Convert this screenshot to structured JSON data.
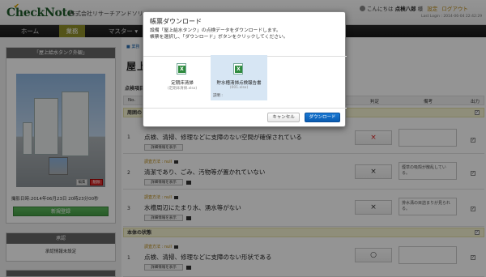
{
  "header": {
    "logo_text": "CheckNote",
    "company": "株式会社リサーチアンドソリュ",
    "greeting_prefix": "こんにちは",
    "user_name": "点検八郎",
    "user_suffix": "様",
    "settings_link": "設定",
    "logout_link": "ログアウト",
    "last_login": "Last Login : 2014-06-04 22:42:29"
  },
  "nav": {
    "home": "ホーム",
    "business": "業務",
    "master": "マスター",
    "master_caret": "▾"
  },
  "left": {
    "panel_title": "「屋上給水タンク外観」",
    "edit_label": "編集",
    "delete_label": "削除",
    "photo_date": "撮影日時:2014年06月23日 20時23分00秒",
    "new_register": "新規登録",
    "approval_title": "承認",
    "approval_body": "承認情報未設定"
  },
  "main": {
    "breadcrumb": "業務",
    "title": "屋上",
    "section_label": "点検項目",
    "columns": {
      "no": "No.",
      "judge": "判定",
      "memo": "備考",
      "output": "出力"
    },
    "groups": [
      {
        "label": "周囲の",
        "check": "✓"
      },
      {
        "label": "本体の状態",
        "check": "✓"
      }
    ],
    "rows": [
      {
        "no": "1",
        "method": "",
        "item": "点検、清掃、修理などに支障のない空間が確保されている",
        "detail": "詳細情報を表示",
        "judge": "×",
        "memo": "",
        "out": "✓"
      },
      {
        "no": "2",
        "method": "調査方法 : null",
        "item": "清潔であり、ごみ、汚物等が置かれていない",
        "detail": "詳細情報を表示",
        "judge": "×",
        "memo": "煙草の吸殻が散乱している。",
        "out": "✓"
      },
      {
        "no": "3",
        "method": "調査方法 : null",
        "item": "水槽周辺にたまり水、湧水等がない",
        "detail": "詳細情報を表示",
        "judge": "×",
        "memo": "排水溝の目詰まりが見られる。",
        "out": "✓"
      },
      {
        "no": "1",
        "method": "調査方法 : null",
        "item": "点検、清掃、修理などに支障のない形状である",
        "detail": "詳細情報を表示",
        "judge": "○",
        "memo": "",
        "out": "✓"
      }
    ]
  },
  "modal": {
    "title": "帳票ダウンロード",
    "desc_line1": "設備「屋上給水タンク」の点検データをダウンロードします。",
    "desc_line2": "帳票を選択し、「ダウンロード」ボタンをクリックしてください。",
    "files": [
      {
        "name": "定期床清掃",
        "sub": "(定期床清掃.xlsx)",
        "desc": ""
      },
      {
        "name": "貯水槽清掃点検報告書",
        "sub": "(001.xlsx)",
        "desc": "説明 :"
      }
    ],
    "cancel": "キャンセル",
    "download": "ダウンロード"
  },
  "colors": {
    "accent_nav": "#8f8f2a",
    "primary_button": "#0a5bb0",
    "danger": "#d33333",
    "success": "#449d44"
  }
}
